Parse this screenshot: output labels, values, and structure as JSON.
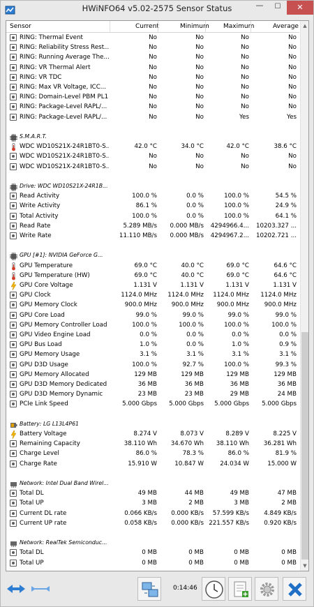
{
  "window": {
    "title": "HWiNFO64 v5.02-2575 Sensor Status",
    "minimize": "—",
    "maximize": "☐",
    "close": "✕"
  },
  "columns": {
    "sensor": "Sensor",
    "current": "Current",
    "minimum": "Minimum",
    "maximum": "Maximum",
    "average": "Average"
  },
  "rows": [
    {
      "type": "item",
      "icon": "sensor-icon",
      "label": "RING: Thermal Event",
      "current": "No",
      "min": "No",
      "max": "No",
      "avg": "No"
    },
    {
      "type": "item",
      "icon": "sensor-icon",
      "label": "RING: Reliability Stress Rest...",
      "current": "No",
      "min": "No",
      "max": "No",
      "avg": "No"
    },
    {
      "type": "item",
      "icon": "sensor-icon",
      "label": "RING: Running Average The...",
      "current": "No",
      "min": "No",
      "max": "No",
      "avg": "No"
    },
    {
      "type": "item",
      "icon": "sensor-icon",
      "label": "RING: VR Thermal Alert",
      "current": "No",
      "min": "No",
      "max": "No",
      "avg": "No"
    },
    {
      "type": "item",
      "icon": "sensor-icon",
      "label": "RING: VR TDC",
      "current": "No",
      "min": "No",
      "max": "No",
      "avg": "No"
    },
    {
      "type": "item",
      "icon": "sensor-icon",
      "label": "RING: Max VR Voltage, ICC...",
      "current": "No",
      "min": "No",
      "max": "No",
      "avg": "No"
    },
    {
      "type": "item",
      "icon": "sensor-icon",
      "label": "RING: Domain-Level PBM PL1",
      "current": "No",
      "min": "No",
      "max": "No",
      "avg": "No"
    },
    {
      "type": "item",
      "icon": "sensor-icon",
      "label": "RING: Package-Level RAPL/...",
      "current": "No",
      "min": "No",
      "max": "No",
      "avg": "No"
    },
    {
      "type": "item",
      "icon": "sensor-icon",
      "label": "RING: Package-Level RAPL/...",
      "current": "No",
      "min": "No",
      "max": "Yes",
      "avg": "Yes"
    },
    {
      "type": "blank"
    },
    {
      "type": "group",
      "icon": "chip-icon",
      "label": "S.M.A.R.T."
    },
    {
      "type": "item",
      "icon": "thermometer-icon",
      "label": "WDC WD10S21X-24R1BT0-S...",
      "current": "42.0 °C",
      "min": "34.0 °C",
      "max": "42.0 °C",
      "avg": "38.6 °C"
    },
    {
      "type": "item",
      "icon": "sensor-icon",
      "label": "WDC WD10S21X-24R1BT0-S...",
      "current": "No",
      "min": "No",
      "max": "No",
      "avg": "No"
    },
    {
      "type": "item",
      "icon": "sensor-icon",
      "label": "WDC WD10S21X-24R1BT0-S...",
      "current": "No",
      "min": "No",
      "max": "No",
      "avg": "No"
    },
    {
      "type": "blank"
    },
    {
      "type": "group",
      "icon": "chip-icon",
      "label": "Drive: WDC WD10S21X-24R1B..."
    },
    {
      "type": "item",
      "icon": "sensor-icon",
      "label": "Read Activity",
      "current": "100.0 %",
      "min": "0.0 %",
      "max": "100.0 %",
      "avg": "54.5 %"
    },
    {
      "type": "item",
      "icon": "sensor-icon",
      "label": "Write Activity",
      "current": "86.1 %",
      "min": "0.0 %",
      "max": "100.0 %",
      "avg": "24.9 %"
    },
    {
      "type": "item",
      "icon": "sensor-icon",
      "label": "Total Activity",
      "current": "100.0 %",
      "min": "0.0 %",
      "max": "100.0 %",
      "avg": "64.1 %"
    },
    {
      "type": "item",
      "icon": "sensor-icon",
      "label": "Read Rate",
      "current": "5.289 MB/s",
      "min": "0.000 MB/s",
      "max": "4294966.4...",
      "avg": "10203.327 ..."
    },
    {
      "type": "item",
      "icon": "sensor-icon",
      "label": "Write Rate",
      "current": "11.110 MB/s",
      "min": "0.000 MB/s",
      "max": "4294967.2...",
      "avg": "10202.721 ..."
    },
    {
      "type": "blank"
    },
    {
      "type": "group",
      "icon": "chip-icon",
      "label": "GPU [#1]: NVIDIA GeForce G..."
    },
    {
      "type": "item",
      "icon": "thermometer-icon",
      "label": "GPU Temperature",
      "current": "69.0 °C",
      "min": "40.0 °C",
      "max": "69.0 °C",
      "avg": "64.6 °C"
    },
    {
      "type": "item",
      "icon": "thermometer-icon",
      "label": "GPU Temperature (HW)",
      "current": "69.0 °C",
      "min": "40.0 °C",
      "max": "69.0 °C",
      "avg": "64.6 °C"
    },
    {
      "type": "item",
      "icon": "lightning-icon",
      "label": "GPU Core Voltage",
      "current": "1.131 V",
      "min": "1.131 V",
      "max": "1.131 V",
      "avg": "1.131 V"
    },
    {
      "type": "item",
      "icon": "sensor-icon",
      "label": "GPU Clock",
      "current": "1124.0 MHz",
      "min": "1124.0 MHz",
      "max": "1124.0 MHz",
      "avg": "1124.0 MHz"
    },
    {
      "type": "item",
      "icon": "sensor-icon",
      "label": "GPU Memory Clock",
      "current": "900.0 MHz",
      "min": "900.0 MHz",
      "max": "900.0 MHz",
      "avg": "900.0 MHz"
    },
    {
      "type": "item",
      "icon": "sensor-icon",
      "label": "GPU Core Load",
      "current": "99.0 %",
      "min": "99.0 %",
      "max": "99.0 %",
      "avg": "99.0 %"
    },
    {
      "type": "item",
      "icon": "sensor-icon",
      "label": "GPU Memory Controller Load",
      "current": "100.0 %",
      "min": "100.0 %",
      "max": "100.0 %",
      "avg": "100.0 %"
    },
    {
      "type": "item",
      "icon": "sensor-icon",
      "label": "GPU Video Engine Load",
      "current": "0.0 %",
      "min": "0.0 %",
      "max": "0.0 %",
      "avg": "0.0 %"
    },
    {
      "type": "item",
      "icon": "sensor-icon",
      "label": "GPU Bus Load",
      "current": "1.0 %",
      "min": "0.0 %",
      "max": "1.0 %",
      "avg": "0.9 %"
    },
    {
      "type": "item",
      "icon": "sensor-icon",
      "label": "GPU Memory Usage",
      "current": "3.1 %",
      "min": "3.1 %",
      "max": "3.1 %",
      "avg": "3.1 %"
    },
    {
      "type": "item",
      "icon": "sensor-icon",
      "label": "GPU D3D Usage",
      "current": "100.0 %",
      "min": "92.7 %",
      "max": "100.0 %",
      "avg": "99.3 %"
    },
    {
      "type": "item",
      "icon": "sensor-icon",
      "label": "GPU Memory Allocated",
      "current": "129 MB",
      "min": "129 MB",
      "max": "129 MB",
      "avg": "129 MB"
    },
    {
      "type": "item",
      "icon": "sensor-icon",
      "label": "GPU D3D Memory Dedicated",
      "current": "36 MB",
      "min": "36 MB",
      "max": "36 MB",
      "avg": "36 MB"
    },
    {
      "type": "item",
      "icon": "sensor-icon",
      "label": "GPU D3D Memory Dynamic",
      "current": "23 MB",
      "min": "23 MB",
      "max": "29 MB",
      "avg": "24 MB"
    },
    {
      "type": "item",
      "icon": "sensor-icon",
      "label": "PCIe Link Speed",
      "current": "5.000 Gbps",
      "min": "5.000 Gbps",
      "max": "5.000 Gbps",
      "avg": "5.000 Gbps"
    },
    {
      "type": "blank"
    },
    {
      "type": "group",
      "icon": "battery-icon",
      "label": "Battery: LG L13L4P61"
    },
    {
      "type": "item",
      "icon": "lightning-icon",
      "label": "Battery Voltage",
      "current": "8.274 V",
      "min": "8.073 V",
      "max": "8.289 V",
      "avg": "8.225 V"
    },
    {
      "type": "item",
      "icon": "sensor-icon",
      "label": "Remaining Capacity",
      "current": "38.110 Wh",
      "min": "34.670 Wh",
      "max": "38.110 Wh",
      "avg": "36.281 Wh"
    },
    {
      "type": "item",
      "icon": "sensor-icon",
      "label": "Charge Level",
      "current": "86.0 %",
      "min": "78.3 %",
      "max": "86.0 %",
      "avg": "81.9 %"
    },
    {
      "type": "item",
      "icon": "sensor-icon",
      "label": "Charge Rate",
      "current": "15.910 W",
      "min": "10.847 W",
      "max": "24.034 W",
      "avg": "15.000 W"
    },
    {
      "type": "blank"
    },
    {
      "type": "group",
      "icon": "network-icon",
      "label": "Network: Intel Dual Band Wirel..."
    },
    {
      "type": "item",
      "icon": "sensor-icon",
      "label": "Total DL",
      "current": "49 MB",
      "min": "44 MB",
      "max": "49 MB",
      "avg": "47 MB"
    },
    {
      "type": "item",
      "icon": "sensor-icon",
      "label": "Total UP",
      "current": "3 MB",
      "min": "2 MB",
      "max": "3 MB",
      "avg": "2 MB"
    },
    {
      "type": "item",
      "icon": "sensor-icon",
      "label": "Current DL rate",
      "current": "0.066 KB/s",
      "min": "0.000 KB/s",
      "max": "57.599 KB/s",
      "avg": "4.849 KB/s"
    },
    {
      "type": "item",
      "icon": "sensor-icon",
      "label": "Current UP rate",
      "current": "0.058 KB/s",
      "min": "0.000 KB/s",
      "max": "221.557 KB/s",
      "avg": "0.920 KB/s"
    },
    {
      "type": "blank"
    },
    {
      "type": "group",
      "icon": "network-icon",
      "label": "Network: RealTek Semiconduc..."
    },
    {
      "type": "item",
      "icon": "sensor-icon",
      "label": "Total DL",
      "current": "0 MB",
      "min": "0 MB",
      "max": "0 MB",
      "avg": "0 MB"
    },
    {
      "type": "item",
      "icon": "sensor-icon",
      "label": "Total UP",
      "current": "0 MB",
      "min": "0 MB",
      "max": "0 MB",
      "avg": "0 MB"
    }
  ],
  "toolbar": {
    "elapsed": "0:14:46"
  },
  "colors": {
    "accent_blue": "#1f6fc6",
    "thermo_red": "#d23a2a",
    "lightning_yellow": "#f0b400",
    "close_red": "#c75050"
  }
}
